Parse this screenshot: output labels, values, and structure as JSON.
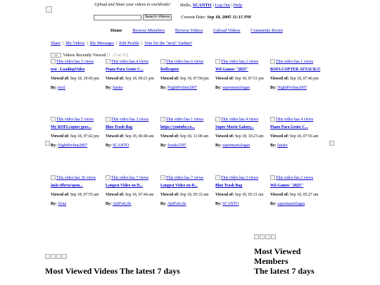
{
  "header": {
    "tagline": "Upload and Share your videos in worldwide!",
    "hello": "Hello,",
    "username": "SCANTO",
    "sep1": " | ",
    "logout": "Log Out",
    "sep2": " | ",
    "help": "Help",
    "search_button": "Search Videos",
    "search_value": "",
    "date_label": "Current Date:",
    "date_value": "Sep 18, 2005",
    "time_value": "11:15 PM"
  },
  "nav": [
    "Home",
    "Browse Members",
    "Browse Videos",
    "Upload Videos",
    "Comments Room"
  ],
  "subnav": [
    "Share",
    "My Videos",
    "My Messages",
    "Edit Profile",
    "Vote for the \"next\" Update!"
  ],
  "section": {
    "title": "Videos Recently Viewed",
    "range": "[1 - 5 of 15]"
  },
  "labels": {
    "viewed_of": "Viewed of:",
    "by": "By:"
  },
  "rows": [
    [
      {
        "thumb": "This video has 5 views",
        "title": "test - LoadingVideo",
        "date": "Sep 18, 10:45 pm",
        "user": "test1"
      },
      {
        "thumb": "This video has 4 views",
        "title": "Piano Para Gente C...",
        "date": "Sep 18, 09:21 pm",
        "user": "luisito"
      },
      {
        "thumb": "This video has 6 views",
        "title": "Roflcopter",
        "date": "Sep 18, 07:58 pm",
        "user": "NightProfine2007"
      },
      {
        "thumb": "This video has 2 views",
        "title": "Wii Games \"2025\"",
        "date": "Sep 18, 07:51 pm",
        "user": "supermariologan"
      },
      {
        "thumb": "This video has 1 views",
        "title": "ROFLCOPTER ATTACK!!!",
        "date": "Sep 18, 07:46 pm",
        "user": "NightProfine2007"
      }
    ],
    [
      {
        "thumb": "This video has 5 views",
        "title": "My ROFLcopter goes...",
        "date": "Sep 18, 07:42 pm",
        "user": "NightProfine2007"
      },
      {
        "thumb": "This video has 3 views",
        "title": "Blue Trash Bag",
        "date": "Sep 18, 06:48 am",
        "user": "SCANTO"
      },
      {
        "thumb": "This video has 1 views",
        "title": "https://youtube.co...",
        "date": "Sep 18, 11:00 am",
        "user": "franko2587"
      },
      {
        "thumb": "This video has 4 views",
        "title": "Super Mario Galaxy...",
        "date": "Sep 18, 10:23 am",
        "user": "supermariologan"
      },
      {
        "thumb": "This video has 4 views",
        "title": "Piano Para Gente C...",
        "date": "Sep 18, 07:56 am",
        "user": "luisito"
      }
    ],
    [
      {
        "thumb": "This video has 36 views",
        "title": "ânât effects/spon...",
        "date": "Sep 18, 07:55 am",
        "user": "Vista"
      },
      {
        "thumb": "This video has 7 views",
        "title": "Longest Video on D...",
        "date": "Sep 18, 07:44 am",
        "user": "AjitForLife"
      },
      {
        "thumb": "This video has 7 views",
        "title": "Longest Video on D...",
        "date": "Sep 18, 05:33 am",
        "user": "AjitForLife"
      },
      {
        "thumb": "This video has 3 views",
        "title": "Blue Trash Bag",
        "date": "Sep 18, 05:31 am",
        "user": "SCANTO"
      },
      {
        "thumb": "This video has 2 views",
        "title": "Wii Games \"2025\"",
        "date": "Sep 18, 05:27 am",
        "user": "supermariologan"
      }
    ]
  ],
  "most_viewed_videos": {
    "title": "Most Viewed Videos The latest 7 days"
  },
  "most_viewed_members": {
    "line1": "Most Viewed",
    "line2": "Members",
    "line3": "The latest 7 days"
  }
}
